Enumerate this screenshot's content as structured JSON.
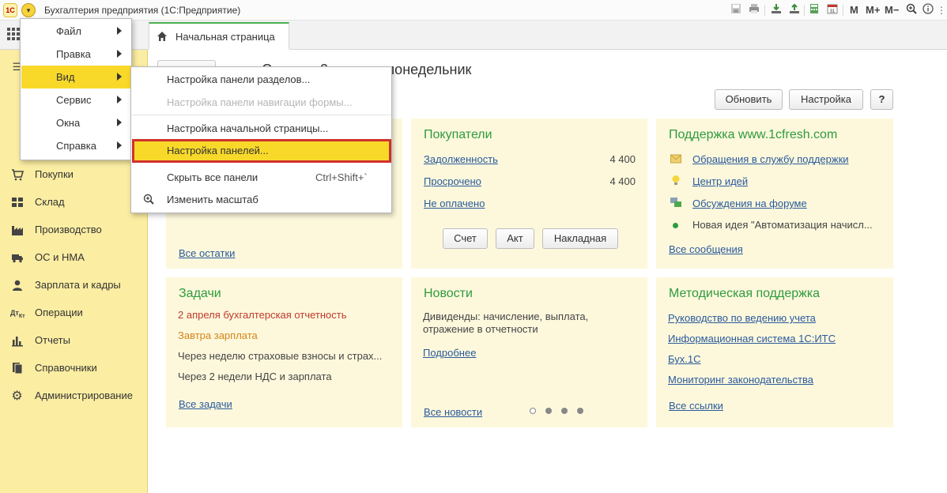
{
  "titlebar": {
    "logo": "1С",
    "app_title": "Бухгалтерия предприятия   (1С:Предприятие)",
    "m_label": "M",
    "mplus_label": "M+",
    "mminus_label": "M−"
  },
  "tab": {
    "home_label": "Начальная страница"
  },
  "page": {
    "title": "Сегодня 2 апреля, понедельник",
    "refresh_label": "Обновить",
    "settings_label": "Настройка",
    "help_label": "?"
  },
  "sidebar": {
    "items": [
      {
        "label": "Покупки",
        "icon": "cart-icon"
      },
      {
        "label": "Склад",
        "icon": "warehouse-icon"
      },
      {
        "label": "Производство",
        "icon": "factory-icon"
      },
      {
        "label": "ОС и НМА",
        "icon": "truck-icon"
      },
      {
        "label": "Зарплата и кадры",
        "icon": "person-icon"
      },
      {
        "label": "Операции",
        "icon": "operations-icon"
      },
      {
        "label": "Отчеты",
        "icon": "bar-chart-icon"
      },
      {
        "label": "Справочники",
        "icon": "books-icon"
      },
      {
        "label": "Администрирование",
        "icon": "gear-icon"
      }
    ]
  },
  "menu": {
    "items": [
      {
        "label": "Файл"
      },
      {
        "label": "Правка"
      },
      {
        "label": "Вид"
      },
      {
        "label": "Сервис"
      },
      {
        "label": "Окна"
      },
      {
        "label": "Справка"
      }
    ],
    "view_submenu": [
      {
        "label": "Настройка панели разделов..."
      },
      {
        "label": "Настройка панели навигации формы..."
      },
      {
        "label": "Настройка начальной страницы..."
      },
      {
        "label": "Настройка панелей..."
      },
      {
        "label": "Скрыть все панели",
        "shortcut": "Ctrl+Shift+`"
      },
      {
        "label": "Изменить масштаб"
      }
    ]
  },
  "stock_panel": {
    "all_link": "Все остатки"
  },
  "buyers_panel": {
    "title": "Покупатели",
    "rows": [
      {
        "label": "Задолженность",
        "value": "4 400"
      },
      {
        "label": "Просрочено",
        "value": "4 400"
      },
      {
        "label": "Не оплачено",
        "value": ""
      }
    ],
    "buttons": [
      "Счет",
      "Акт",
      "Накладная"
    ]
  },
  "support_panel": {
    "title": "Поддержка www.1cfresh.com",
    "links": [
      "Обращения в службу поддержки",
      "Центр идей",
      "Обсуждения на форуме"
    ],
    "news_text": "Новая идея \"Автоматизация начисл...",
    "all_link": "Все сообщения"
  },
  "tasks_panel": {
    "title": "Задачи",
    "items": [
      {
        "text": "2 апреля бухгалтерская отчетность",
        "color": "#c0392b"
      },
      {
        "text": "Завтра зарплата",
        "color": "#d4831a"
      },
      {
        "text": "Через неделю страховые взносы и страх...",
        "color": "#444444"
      },
      {
        "text": "Через 2 недели НДС и зарплата",
        "color": "#444444"
      }
    ],
    "all_link": "Все задачи"
  },
  "news_panel": {
    "title": "Новости",
    "text_line1": "Дивиденды: начисление, выплата,",
    "text_line2": "отражение в отчетности",
    "more_link": "Подробнее",
    "all_link": "Все новости"
  },
  "method_panel": {
    "title": "Методическая поддержка",
    "links": [
      "Руководство по ведению учета",
      "Информационная система 1С:ИТС",
      "Бух.1С",
      "Мониторинг законодательства"
    ],
    "all_link": "Все ссылки"
  },
  "colors": {
    "sidebar_bg": "#fbeda2",
    "panel_bg": "#fdf8dc",
    "menu_highlight": "#f8d92a",
    "highlight_border": "#d0312d",
    "panel_title": "#2e9b3e",
    "link": "#2a5a9c"
  }
}
